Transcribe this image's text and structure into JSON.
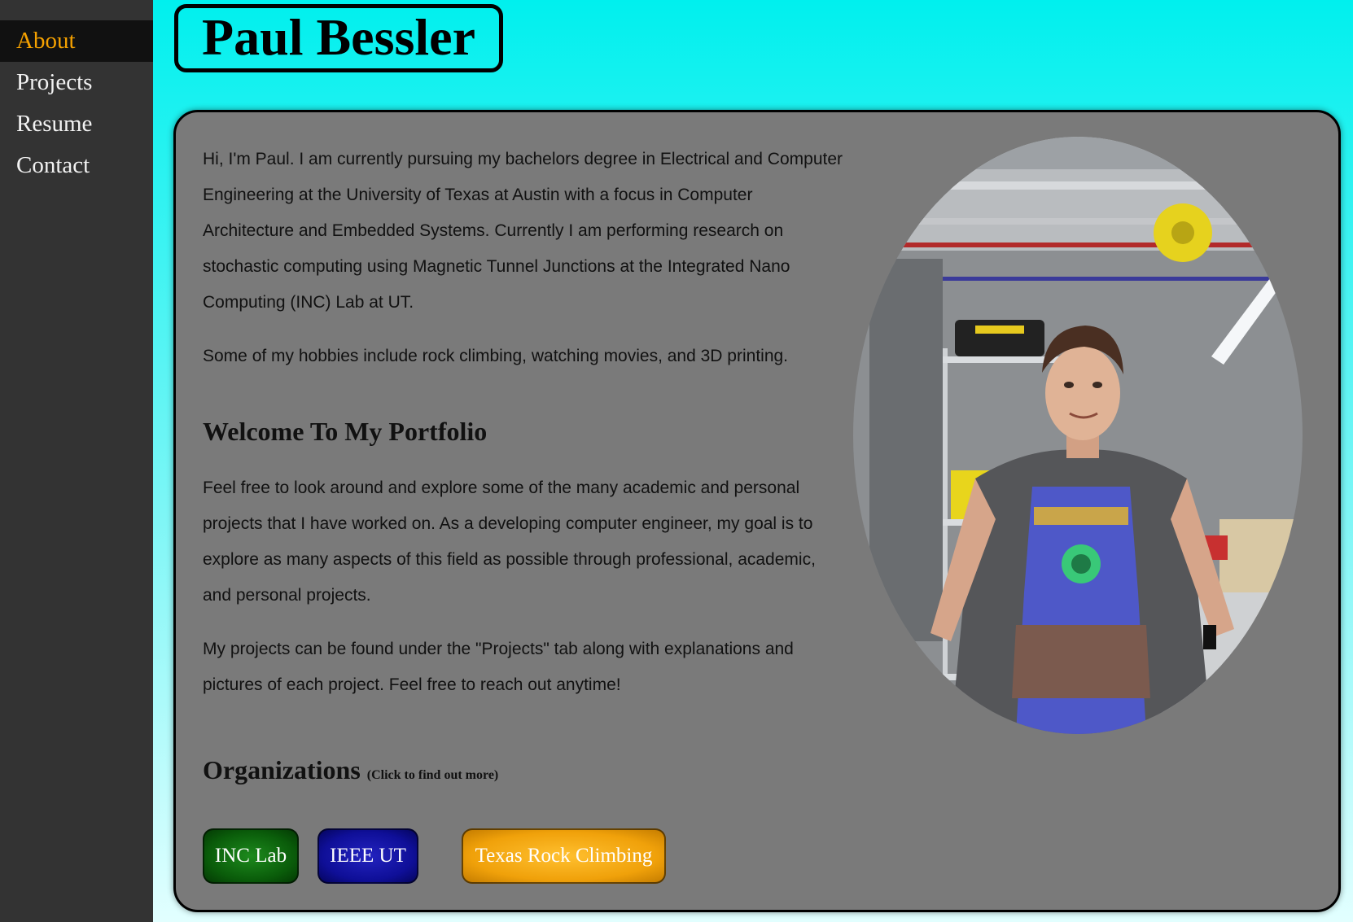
{
  "nav": {
    "items": [
      {
        "label": "About",
        "active": true
      },
      {
        "label": "Projects",
        "active": false
      },
      {
        "label": "Resume",
        "active": false
      },
      {
        "label": "Contact",
        "active": false
      }
    ]
  },
  "header": {
    "name": "Paul Bessler"
  },
  "about": {
    "intro": "Hi, I'm Paul. I am currently pursuing my bachelors degree in Electrical and Computer Engineering at the University of Texas at Austin with a focus in Computer Architecture and Embedded Systems. Currently I am performing research on stochastic computing using Magnetic Tunnel Junctions at the Integrated Nano Computing (INC) Lab at UT.",
    "hobbies": "Some of my hobbies include rock climbing, watching movies, and 3D printing.",
    "welcome_heading": "Welcome To My Portfolio",
    "welcome_text": "Feel free to look around and explore some of the many academic and personal projects that I have worked on. As a developing computer engineer, my goal is to explore as many aspects of this field as possible through professional, academic, and personal projects.",
    "projects_text": "My projects can be found under the \"Projects\" tab along with explanations and pictures of each project. Feel free to reach out anytime!"
  },
  "organizations": {
    "heading": "Organizations",
    "note": "(Click to find out more)",
    "buttons": [
      {
        "label": "INC Lab",
        "color": "#0a5c0a"
      },
      {
        "label": "IEEE UT",
        "color": "#0f0f98"
      },
      {
        "label": "Texas Rock Climbing",
        "color": "#f0a10a"
      }
    ]
  },
  "colors": {
    "sidebar": "#333333",
    "active_nav_text": "#f5a100",
    "page_background_top": "#00f0ee",
    "card_background": "#7a7a7a"
  },
  "photo": {
    "subject": "portrait-photo"
  }
}
